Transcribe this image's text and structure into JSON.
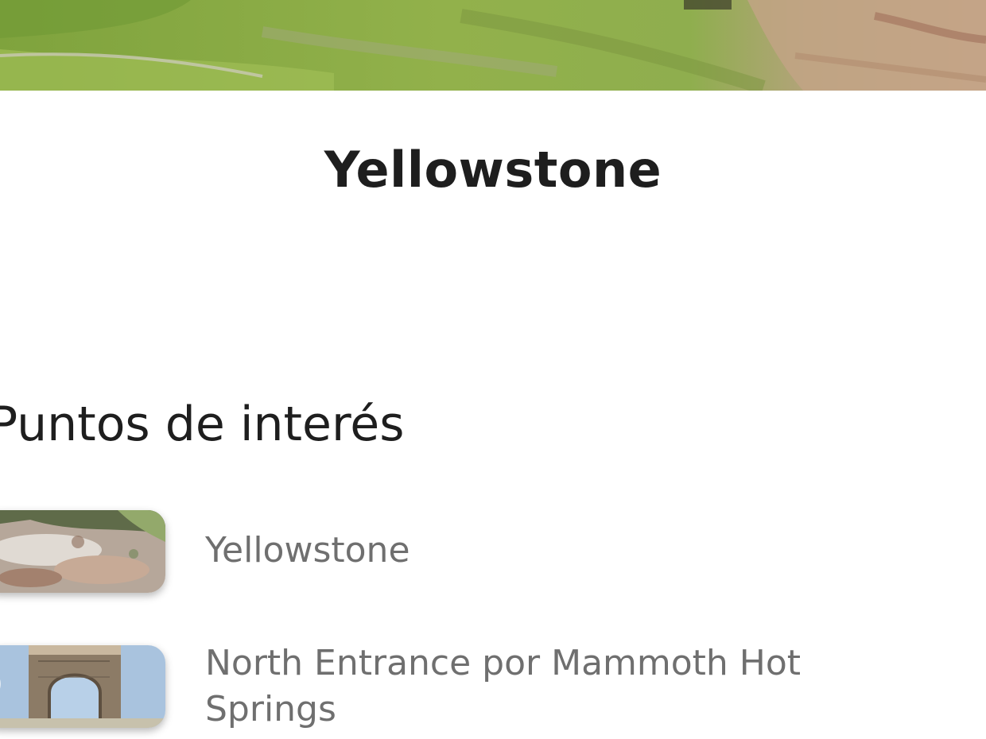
{
  "park": {
    "title": "Yellowstone",
    "hero_image": "yellowstone-landscape-photo"
  },
  "points_of_interest": {
    "heading": "Puntos de interés",
    "items": [
      {
        "label": "Yellowstone",
        "thumbnail": "hot-springs-terraces-photo"
      },
      {
        "label": "North Entrance por Mammoth Hot Springs",
        "thumbnail": "roosevelt-arch-photo"
      }
    ]
  },
  "colors": {
    "title": "#1e1e1e",
    "item_text": "#6f6f6f",
    "background": "#ffffff",
    "hero_green": "#8aa847"
  }
}
